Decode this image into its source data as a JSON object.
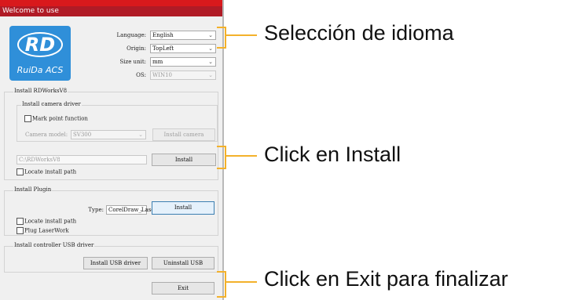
{
  "window": {
    "title": "Welcome to use"
  },
  "logo": {
    "mark": "RD",
    "subtitle": "RuiDa ACS"
  },
  "settings": {
    "language": {
      "label": "Language:",
      "value": "English"
    },
    "origin": {
      "label": "Origin:",
      "value": "TopLeft"
    },
    "size_unit": {
      "label": "Size unit:",
      "value": "mm"
    },
    "os": {
      "label": "OS:",
      "value": "WIN10"
    }
  },
  "rdworks": {
    "header": "Install RDWorksV8",
    "camera_group": "Install camera driver",
    "mark_point": "Mark point function",
    "camera_model_label": "Camera model:",
    "camera_model_value": "SV300",
    "install_camera": "Install camera",
    "path_value": "C:\\RDWorksV8",
    "install": "Install",
    "locate_path": "Locate install path"
  },
  "plugin": {
    "header": "Install Plugin",
    "type_label": "Type:",
    "type_value": "CorelDraw_Laser",
    "install": "Install",
    "locate_path": "Locate install path",
    "plug_laserwork": "Plug LaserWork"
  },
  "usb": {
    "header": "Install controller USB driver",
    "install": "Install USB driver",
    "uninstall": "Uninstall USB"
  },
  "exit_button": "Exit",
  "callouts": {
    "language": "Selección de idioma",
    "install": "Click en Install",
    "exit": "Click en Exit para finalizar"
  },
  "colors": {
    "accent": "#f3b12b",
    "titlebar": "#b01b26",
    "logo": "#2f8fd9"
  }
}
